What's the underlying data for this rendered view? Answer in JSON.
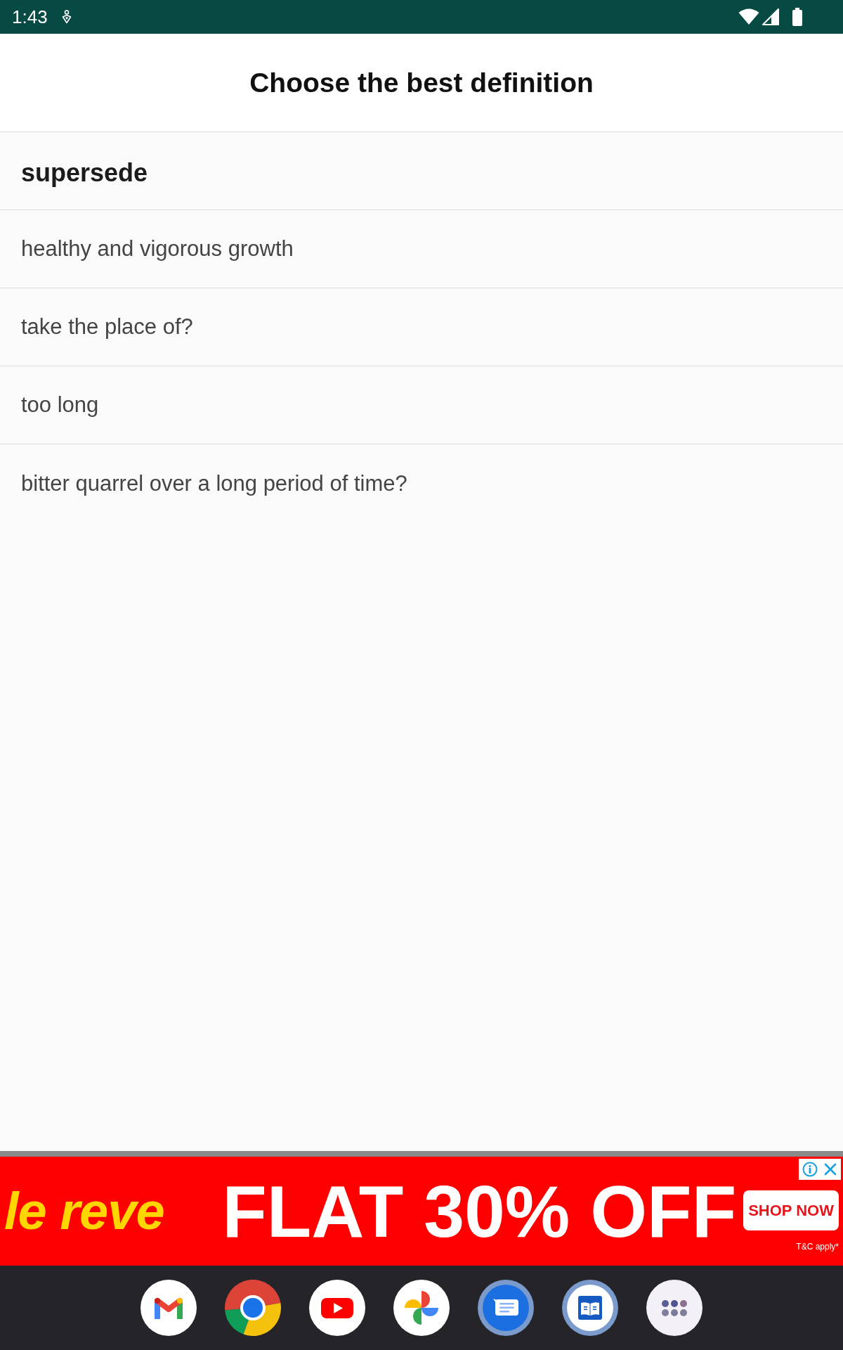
{
  "status_bar": {
    "time": "1:43"
  },
  "header": {
    "title": "Choose the best definition"
  },
  "quiz": {
    "word": "supersede",
    "options": [
      {
        "text": "healthy and vigorous growth",
        "selected": false
      },
      {
        "text": "take the place of?",
        "selected": false
      },
      {
        "text": "too long",
        "selected": false
      },
      {
        "text": "bitter quarrel over a long period of time?",
        "selected": false
      }
    ]
  },
  "ad_banner": {
    "brand": "le reve",
    "headline": "FLAT 30% OFF",
    "button": "SHOP NOW",
    "fine_print": "T&C apply*"
  },
  "dock": {
    "apps": [
      {
        "kind": "mail"
      },
      {
        "kind": "browser"
      },
      {
        "kind": "video"
      },
      {
        "kind": "photos"
      },
      {
        "kind": "messages"
      },
      {
        "kind": "dictionary"
      },
      {
        "kind": "apps"
      }
    ]
  }
}
